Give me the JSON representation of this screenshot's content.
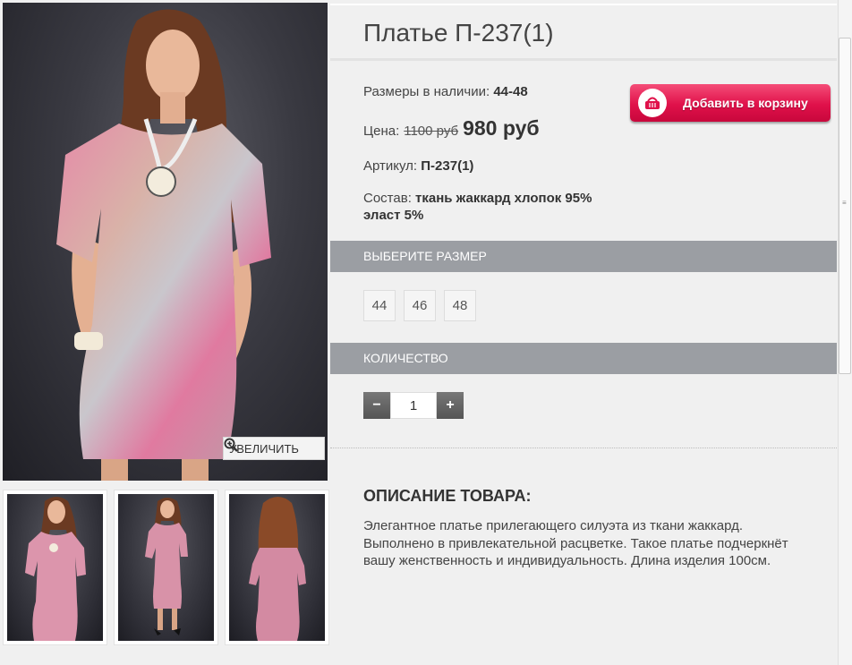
{
  "product": {
    "title": "Платье П-237(1)",
    "sizes_label": "Размеры в наличии:",
    "sizes_value": "44-48",
    "price_label": "Цена:",
    "old_price": "1100 руб",
    "new_price": "980 руб",
    "article_label": "Артикул:",
    "article_value": "П-237(1)",
    "composition_label": "Состав:",
    "composition_value": "ткань жаккард хлопок 95% эласт 5%"
  },
  "gallery": {
    "zoom_label": "УВЕЛИЧИТЬ",
    "zoom_icon": "magnifier-plus-icon"
  },
  "cart": {
    "label": "Добавить в корзину",
    "icon": "basket-icon",
    "color": "#e0114a"
  },
  "size_section": {
    "title": "ВЫБЕРИТЕ РАЗМЕР",
    "options": [
      "44",
      "46",
      "48"
    ]
  },
  "quantity_section": {
    "title": "КОЛИЧЕСТВО",
    "minus": "−",
    "plus": "+",
    "value": "1"
  },
  "description": {
    "title": "ОПИСАНИЕ ТОВАРА:",
    "text": "Элегантное платье прилегающего силуэта из ткани жаккард. Выполнено в привлекательной расцветке. Такое платье подчеркнёт вашу женственность и индивидуальность. Длина изделия 100см."
  },
  "colors": {
    "section_bar": "#9b9ea3",
    "background": "#f0f0f0"
  }
}
